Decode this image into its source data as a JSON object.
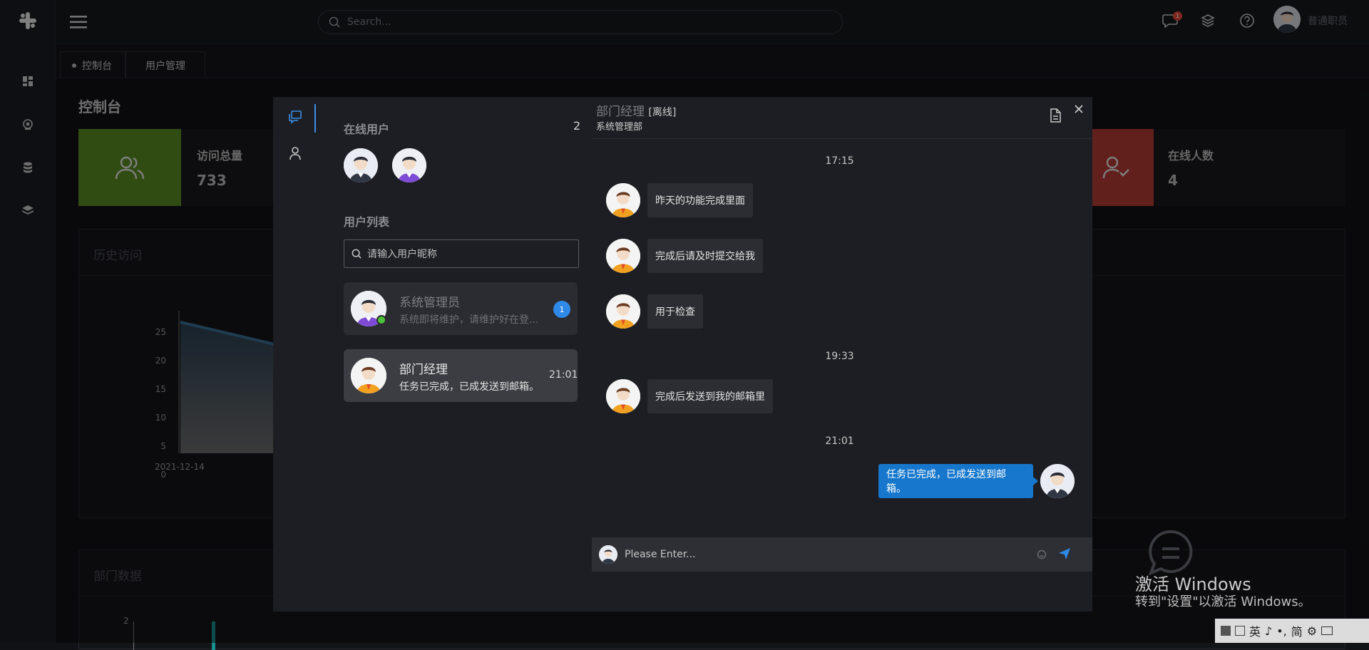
{
  "header": {
    "search_placeholder": "Search...",
    "message_badge": "1",
    "username": "普通职员"
  },
  "tabs": [
    {
      "label": "控制台"
    },
    {
      "label": "用户管理"
    }
  ],
  "page": {
    "title": "控制台",
    "cards": [
      {
        "label": "访问总量",
        "value": "733",
        "color": "#5a8a23"
      },
      {
        "label": "在线人数",
        "value": "4",
        "color": "#b23b35"
      }
    ],
    "history_title": "历史访问",
    "dept_title": "部门数据",
    "history_chart_axis": {
      "ticks": [
        "25",
        "20",
        "15",
        "10",
        "5",
        "0"
      ],
      "first_date": "2021-12-14"
    },
    "dept_chart_tick": "2"
  },
  "chat": {
    "online_title": "在线用户",
    "online_count": "2",
    "list_title": "用户列表",
    "search_placeholder": "请输入用户昵称",
    "users": [
      {
        "name": "系统管理员",
        "message": "系统即将维护，请维护好在登...",
        "badge": "1"
      },
      {
        "name": "部门经理",
        "message": "任务已完成，已成发送到邮箱。",
        "time": "21:01"
      }
    ],
    "header": {
      "name": "部门经理",
      "status": "[离线]",
      "dept": "系统管理部"
    },
    "messages": [
      {
        "time": "17:15"
      },
      {
        "text": "昨天的功能完成里面"
      },
      {
        "text": "完成后请及时提交给我"
      },
      {
        "text": "用于检查"
      },
      {
        "time": "19:33"
      },
      {
        "text": "完成后发送到我的邮箱里"
      },
      {
        "time": "21:01"
      },
      {
        "text": "任务已完成，已成发送到邮箱。",
        "mine": true
      }
    ],
    "input_placeholder": "Please Enter..."
  },
  "windows_watermark": {
    "title": "激活 Windows",
    "subtitle": "转到\"设置\"以激活 Windows。"
  },
  "tray": [
    "英",
    "简"
  ],
  "colors": {
    "accent": "#1677cc",
    "badge": "#e84a3c",
    "online": "#4cc23a"
  }
}
